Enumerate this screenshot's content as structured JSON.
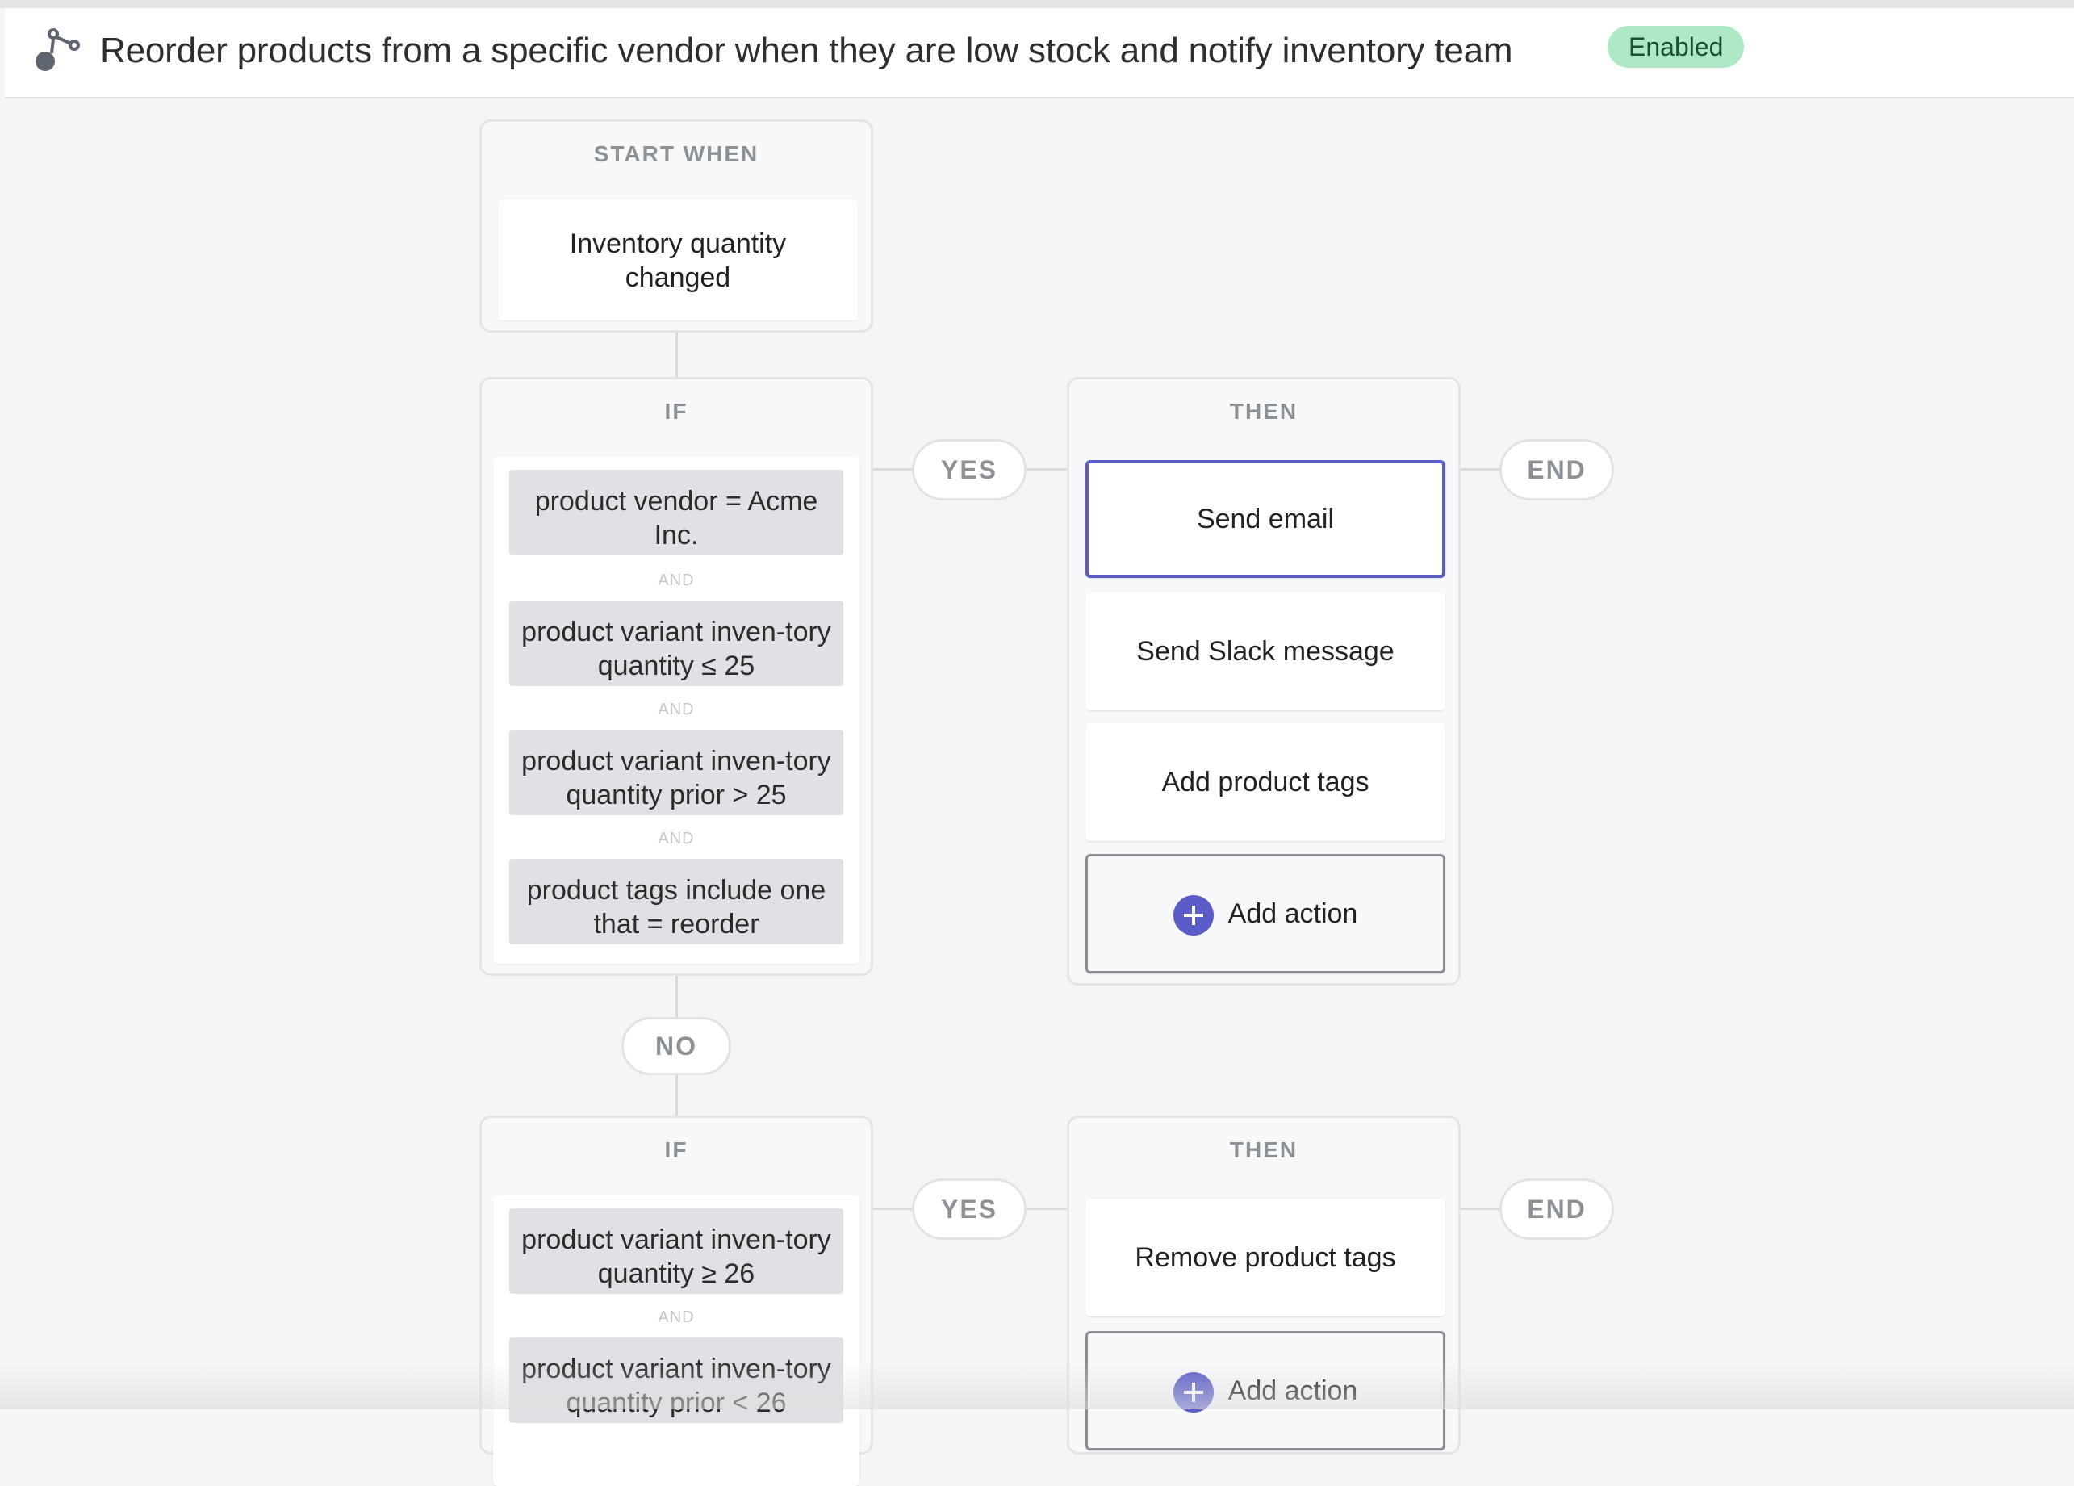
{
  "header": {
    "title": "Reorder products from a specific vendor when they are low stock and notify inventory team",
    "status_badge": "Enabled",
    "icon": "workflow-icon"
  },
  "colors": {
    "accent": "#5c5cc8",
    "badge_bg": "#aee9c5",
    "badge_text": "#1d4d34",
    "condition_bg": "#dfe1e4",
    "canvas_bg": "#f4f5f7"
  },
  "trigger": {
    "heading": "START WHEN",
    "text": "Inventory quantity changed"
  },
  "branch1": {
    "if_heading": "IF",
    "conditions": [
      "product vendor = Acme Inc.",
      "product variant inven-tory quantity ≤ 25",
      "product variant inven-tory quantity prior > 25",
      "product tags include one that = reorder"
    ],
    "and_label": "AND",
    "yes_label": "YES",
    "no_label": "NO",
    "then_heading": "THEN",
    "actions": [
      "Send email",
      "Send Slack message",
      "Add product tags"
    ],
    "add_action_label": "Add action",
    "end_label": "END"
  },
  "branch2": {
    "if_heading": "IF",
    "conditions": [
      "product variant inven-tory quantity ≥ 26",
      "product variant inven-tory quantity prior < 26"
    ],
    "and_label": "AND",
    "yes_label": "YES",
    "then_heading": "THEN",
    "actions": [
      "Remove product tags"
    ],
    "add_action_label": "Add action",
    "end_label": "END"
  }
}
